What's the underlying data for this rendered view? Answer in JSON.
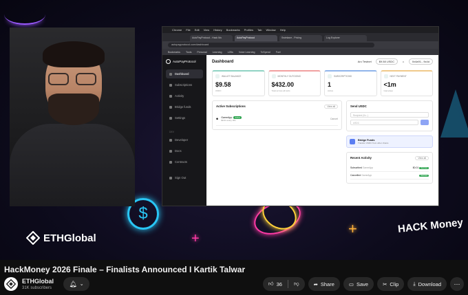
{
  "video": {
    "title": "HackMoney 2026 Finale – Finalists Announced I Kartik Talwar",
    "channel": "ETHGlobal",
    "subscribers": "31K subscribers",
    "overlay_brand": "ETHGlobal",
    "overlay_event": "HACK Money"
  },
  "actions": {
    "like_count": "36",
    "share": "Share",
    "save": "Save",
    "clip": "Clip",
    "download": "Download"
  },
  "browser": {
    "menu": [
      "Chrome",
      "File",
      "Edit",
      "View",
      "History",
      "Bookmarks",
      "Profiles",
      "Tab",
      "Window",
      "Help"
    ],
    "tabs": [
      "AutoPayProtocol - Hack Mo",
      "AutoPayProtocol",
      "Swimlane - Pricing",
      "Log Explorer"
    ],
    "url": "autopayprotocol.com/dashboard",
    "bookmarks": [
      "Bookmarks",
      "Tools",
      "Personal",
      "Learning",
      "L2Bs",
      "Voice Learning",
      "ToSpend",
      "Fuel"
    ]
  },
  "app": {
    "logo": "AutoPayProtocol",
    "nav": [
      "Dashboard",
      "Subscriptions",
      "Activity",
      "Bridge funds",
      "Settings"
    ],
    "dev_section": "DEV",
    "nav2": [
      "Developer",
      "Docs",
      "Contracts",
      "Sign Out"
    ],
    "page_title": "Dashboard",
    "user": "Arc Testnet",
    "balance_chip": "$9.58",
    "balance_unit": "USDC",
    "address_chip": "0x4a91...9c4d",
    "cards": [
      {
        "label": "WALLET BALANCE",
        "value": "$9.58",
        "sub": "USDC"
      },
      {
        "label": "MONTHLY OUTGOING",
        "value": "$432.00",
        "sub": "Total across all subs"
      },
      {
        "label": "SUBSCRIPTIONS",
        "value": "1",
        "sub": "Active"
      },
      {
        "label": "NEXT PAYMENT",
        "value": "<1m",
        "sub": "GameApp"
      }
    ],
    "active_subs": {
      "title": "Active Subscriptions",
      "view_all": "View all",
      "name": "GameApp",
      "status": "Active",
      "amount": "$0.01",
      "freq": "every 30s",
      "action": "Cancel"
    },
    "send": {
      "title": "Send USDC",
      "recipient": "Recipient (0x...)",
      "amount": "USDC"
    },
    "bridge": {
      "title": "Bridge Funds",
      "desc": "Transfer USDC from other chains"
    },
    "recent": {
      "title": "Recent Activity",
      "view_all": "View all",
      "rows": [
        {
          "type": "Subscribed",
          "app": "GameApp",
          "amount": "$0.01",
          "status": "Success"
        },
        {
          "type": "Cancelled",
          "app": "GameApp",
          "amount": "",
          "status": "Success"
        }
      ]
    }
  }
}
